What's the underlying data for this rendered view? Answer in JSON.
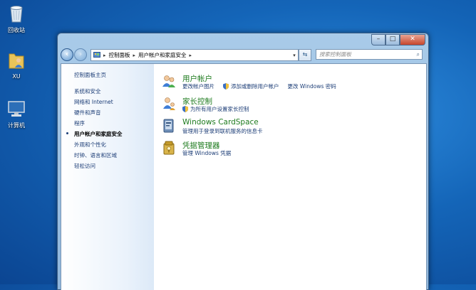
{
  "desktop": {
    "icons": [
      {
        "label": "回收站",
        "icon": "recycle-bin-icon"
      },
      {
        "label": "XU",
        "icon": "user-folder-icon"
      },
      {
        "label": "计算机",
        "icon": "computer-icon"
      }
    ]
  },
  "window": {
    "caption_buttons": {
      "minimize": "–",
      "maximize": "□",
      "close": "✕"
    },
    "address_bar": {
      "crumbs": [
        "控制面板",
        "用户帐户和家庭安全"
      ]
    },
    "search": {
      "placeholder": "搜索控制面板"
    }
  },
  "sidebar": {
    "home": "控制面板主页",
    "items": [
      {
        "label": "系统和安全"
      },
      {
        "label": "网络和 Internet"
      },
      {
        "label": "硬件和声音"
      },
      {
        "label": "程序"
      },
      {
        "label": "用户帐户和家庭安全",
        "active": true
      },
      {
        "label": "外观和个性化"
      },
      {
        "label": "时钟、语言和区域"
      },
      {
        "label": "轻松访问"
      }
    ]
  },
  "categories": [
    {
      "title": "用户帐户",
      "icon": "users-icon",
      "links": [
        {
          "label": "更改帐户图片",
          "shield": false
        },
        {
          "label": "添加或删除用户帐户",
          "shield": true
        },
        {
          "label": "更改 Windows 密码",
          "shield": false
        }
      ]
    },
    {
      "title": "家长控制",
      "icon": "parental-controls-icon",
      "links": [
        {
          "label": "为所有用户设置家长控制",
          "shield": true
        }
      ]
    },
    {
      "title": "Windows CardSpace",
      "icon": "cardspace-icon",
      "links": [
        {
          "label": "管理用于登录到联机服务的信息卡",
          "shield": false
        }
      ]
    },
    {
      "title": "凭据管理器",
      "icon": "credential-manager-icon",
      "links": [
        {
          "label": "管理 Windows 凭据",
          "shield": false
        }
      ]
    }
  ],
  "colors": {
    "link": "#1d3e77",
    "category_title": "#1e7b1e",
    "desktop": "#1465b8"
  }
}
